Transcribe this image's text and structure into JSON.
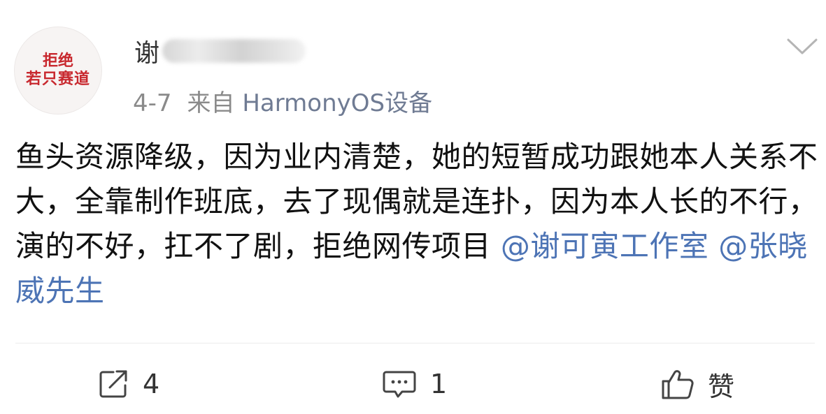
{
  "avatar": {
    "line1": "拒绝",
    "line2": "若只赛道"
  },
  "user": {
    "name_visible": "谢"
  },
  "meta": {
    "date": "4-7",
    "source_prefix": "来自",
    "device": "HarmonyOS设备"
  },
  "post": {
    "text": "鱼头资源降级，因为业内清楚，她的短暂成功跟她本人关系不大，全靠制作班底，去了现偶就是连扑，因为本人长的不行，演的不好，扛不了剧，拒绝网传项目",
    "mention1": "@谢可寅工作室",
    "mention2": "@张晓威先生"
  },
  "actions": {
    "repost_count": "4",
    "comment_count": "1",
    "like_label": "赞"
  },
  "colors": {
    "mention": "#4d74b5",
    "avatar_text": "#c8282e",
    "meta": "#8a8a8a"
  },
  "icons": {
    "expand": "chevron-down-icon",
    "repost": "share-icon",
    "comment": "comment-icon",
    "like": "thumbs-up-icon"
  }
}
